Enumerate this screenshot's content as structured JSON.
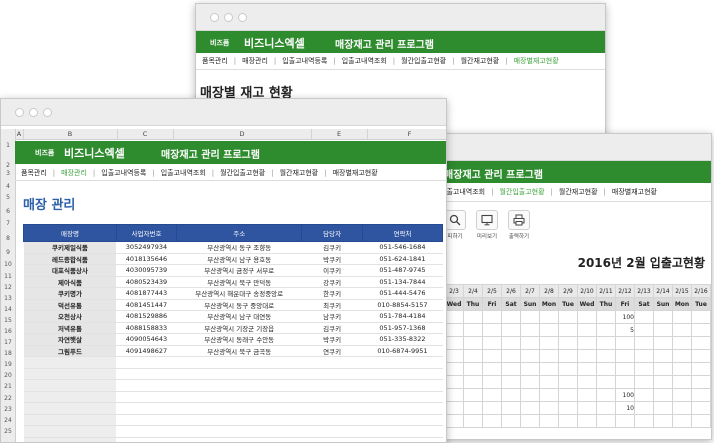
{
  "brand_small": "비즈폼",
  "brand": "비즈니스엑셀",
  "program_title": "매장재고 관리 프로그램",
  "win1": {
    "menu": [
      "품목관리",
      "매장관리",
      "입출고내역등록",
      "입출고내역조회",
      "월간입출고현황",
      "월간재고현황",
      "매장별재고현황"
    ],
    "active": 6,
    "heading": "매장별 재고 현황"
  },
  "win2": {
    "menu": [
      "입출고내역조회",
      "월간입출고현황",
      "월간재고현황",
      "매장별재고현황"
    ],
    "active": 1,
    "tools": [
      {
        "label": "피하기",
        "icon": "search-icon"
      },
      {
        "label": "미리보기",
        "icon": "monitor-icon"
      },
      {
        "label": "출력하기",
        "icon": "printer-icon"
      }
    ],
    "heading": "2016년 2월 입출고현황",
    "dates": [
      "2/3",
      "2/4",
      "2/5",
      "2/6",
      "2/7",
      "2/8",
      "2/9",
      "2/10",
      "2/11",
      "2/12",
      "2/13",
      "2/14",
      "2/15",
      "2/16"
    ],
    "days": [
      "Wed",
      "Thu",
      "Fri",
      "Sat",
      "Sun",
      "Mon",
      "Tue",
      "Wed",
      "Thu",
      "Fri",
      "Sat",
      "Sun",
      "Mon",
      "Tue"
    ],
    "values": [
      [
        "",
        "",
        "",
        "",
        "",
        "",
        "",
        "",
        "",
        "100",
        "",
        "",
        "",
        ""
      ],
      [
        "",
        "",
        "",
        "",
        "",
        "",
        "",
        "",
        "",
        "5",
        "",
        "",
        "",
        ""
      ],
      [
        "",
        "",
        "",
        "",
        "",
        "",
        "",
        "",
        "",
        "",
        "",
        "",
        "",
        ""
      ],
      [
        "",
        "",
        "",
        "",
        "",
        "",
        "",
        "",
        "",
        "",
        "",
        "",
        "",
        ""
      ],
      [
        "",
        "",
        "",
        "",
        "",
        "",
        "",
        "",
        "",
        "",
        "",
        "",
        "",
        ""
      ],
      [
        "",
        "",
        "",
        "",
        "",
        "",
        "",
        "",
        "",
        "",
        "",
        "",
        "",
        ""
      ],
      [
        "",
        "",
        "",
        "",
        "",
        "",
        "",
        "",
        "",
        "100",
        "",
        "",
        "",
        ""
      ],
      [
        "",
        "",
        "",
        "",
        "",
        "",
        "",
        "",
        "",
        "10",
        "",
        "",
        "",
        ""
      ],
      [
        "",
        "",
        "",
        "",
        "",
        "",
        "",
        "",
        "",
        "",
        "",
        "",
        "",
        ""
      ]
    ]
  },
  "win3": {
    "columns": [
      "A",
      "B",
      "C",
      "D",
      "E",
      "F"
    ],
    "rows": [
      "1",
      "2",
      "3",
      "4",
      "5",
      "6",
      "7",
      "8",
      "9",
      "10",
      "11",
      "12",
      "13",
      "14",
      "15",
      "16",
      "17",
      "18",
      "19",
      "20",
      "21",
      "22",
      "23",
      "24",
      "25"
    ],
    "menu": [
      "품목관리",
      "매장관리",
      "입출고내역등록",
      "입출고내역조회",
      "월간입출고현황",
      "월간재고현황",
      "매장별재고현황"
    ],
    "active": 1,
    "heading": "매장 관리",
    "table_headers": [
      "매장명",
      "사업자번호",
      "주소",
      "담당자",
      "연락처"
    ],
    "table_rows": [
      [
        "쿠키제일식품",
        "3052497934",
        "부산광역시 동구 조향동",
        "김쿠키",
        "051-546-1684"
      ],
      [
        "레드종합식품",
        "4018135646",
        "부산광역시 남구 용호동",
        "박쿠키",
        "051-624-1841"
      ],
      [
        "대포식품상사",
        "4030095739",
        "부산광역시 금정구 서부로",
        "이쿠키",
        "051-487-9745"
      ],
      [
        "제아식품",
        "4080523439",
        "부산광역시 북구 만덕동",
        "강쿠키",
        "051-134-7844"
      ],
      [
        "쿠키명가",
        "4081877443",
        "부산광역시 해운대구 송정중앙로",
        "한쿠키",
        "051-444-5476"
      ],
      [
        "덕선유통",
        "4081451447",
        "부산광역시 동구 중앙대로",
        "최쿠키",
        "010-8854-5157"
      ],
      [
        "오천상사",
        "4081529886",
        "부산광역시 남구 대연동",
        "남쿠키",
        "051-784-4184"
      ],
      [
        "저녁유통",
        "4088158833",
        "부산광역시 기장군 기장읍",
        "김쿠키",
        "051-957-1368"
      ],
      [
        "자연햇살",
        "4090054643",
        "부산광역시 동래구 수안동",
        "박쿠키",
        "051-335-8322"
      ],
      [
        "그림푸드",
        "4091498627",
        "부산광역시 북구 금곡동",
        "연쿠키",
        "010-6874-9951"
      ]
    ]
  }
}
